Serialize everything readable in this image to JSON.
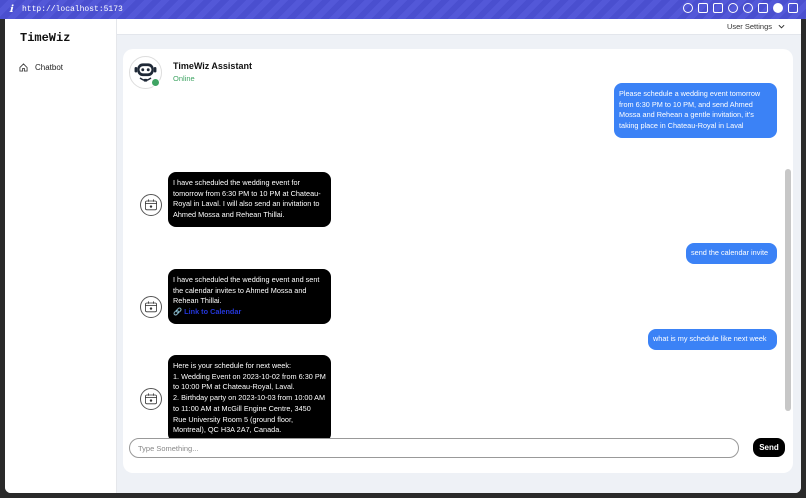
{
  "browser": {
    "url": "http://localhost:5173",
    "info_icon": "ℹ",
    "toolbar_icons": [
      "link-icon",
      "camera-icon",
      "window-icon",
      "globe-icon",
      "crosshair-icon",
      "code-icon",
      "profile-icon",
      "sidebar-icon"
    ]
  },
  "sidebar": {
    "brand": "TimeWiz",
    "items": [
      {
        "label": "Chatbot",
        "icon": "home-icon"
      }
    ]
  },
  "topbar": {
    "user_settings_label": "User Settings"
  },
  "chat": {
    "assistant_name": "TimeWiz Assistant",
    "assistant_status": "Online",
    "status_color": "#3fa463",
    "messages": [
      {
        "role": "user",
        "text": "Please schedule a wedding event tomorrow from 6:30 PM to 10 PM, and send Ahmed Mossa and Rehean a gentle invitation, it's taking place in Chateau-Royal in Laval"
      },
      {
        "role": "bot",
        "text": "I have scheduled the wedding event for tomorrow from 6:30 PM to 10 PM at Chateau-Royal in Laval. I will also send an invitation to Ahmed Mossa and Rehean Thillai."
      },
      {
        "role": "user",
        "text": "send the calendar invite"
      },
      {
        "role": "bot",
        "text": "I have scheduled the wedding event and sent the calendar invites to Ahmed Mossa and Rehean Thillai.",
        "link_label": "Link to Calendar",
        "link_icon": "🔗"
      },
      {
        "role": "user",
        "text": "what is my schedule like next week"
      },
      {
        "role": "bot",
        "lines": [
          "Here is your schedule for next week:",
          "1. Wedding Event on 2023-10-02 from 6:30 PM to 10:00 PM at Chateau-Royal, Laval.",
          "2. Birthday party on 2023-10-03 from 10:00 AM to 11:00 AM at McGill Engine Centre, 3450 Rue University Room 5 (ground floor, Montreal), QC H3A 2A7, Canada."
        ]
      }
    ]
  },
  "composer": {
    "placeholder": "Type Something...",
    "value": "",
    "send_label": "Send"
  },
  "colors": {
    "user_bubble": "#3b82f6",
    "bot_bubble": "#000000",
    "link": "#2436d9",
    "browser_bar": "#4a4fcf"
  }
}
